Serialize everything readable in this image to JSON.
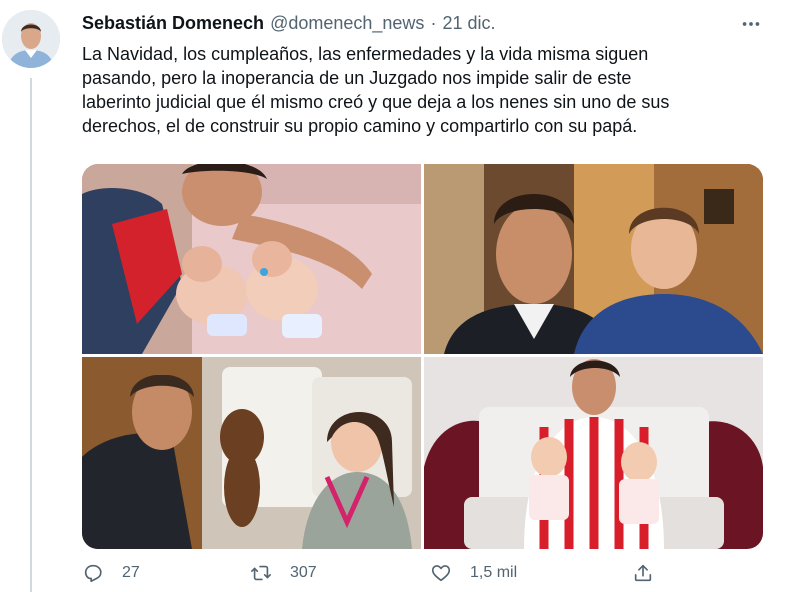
{
  "tweet": {
    "display_name": "Sebastián Domenech",
    "handle": "@domenech_news",
    "separator": "·",
    "date": "21 dic.",
    "text_lines": [
      "La Navidad, los cumpleaños, las enfermedades y la vida misma siguen",
      "pasando, pero la inoperancia de un Juzgado nos impide salir de este",
      "laberinto judicial que él mismo creó y que deja a los nenes sin uno de sus",
      "derechos, el de construir su propio camino y compartirlo con su papá."
    ]
  },
  "media": {
    "photos": [
      {
        "icon": "photo-father-with-twin-babies"
      },
      {
        "icon": "photo-father-with-son"
      },
      {
        "icon": "photo-father-with-daughter"
      },
      {
        "icon": "photo-father-with-twins-on-sofa"
      }
    ]
  },
  "actions": {
    "reply_count": "27",
    "retweet_count": "307",
    "like_count": "1,5 mil",
    "icons": [
      "reply-icon",
      "retweet-icon",
      "like-icon",
      "share-icon"
    ]
  },
  "colors": {
    "text": "#0f1419",
    "secondary": "#536471",
    "thread_line": "#cfd9de"
  }
}
